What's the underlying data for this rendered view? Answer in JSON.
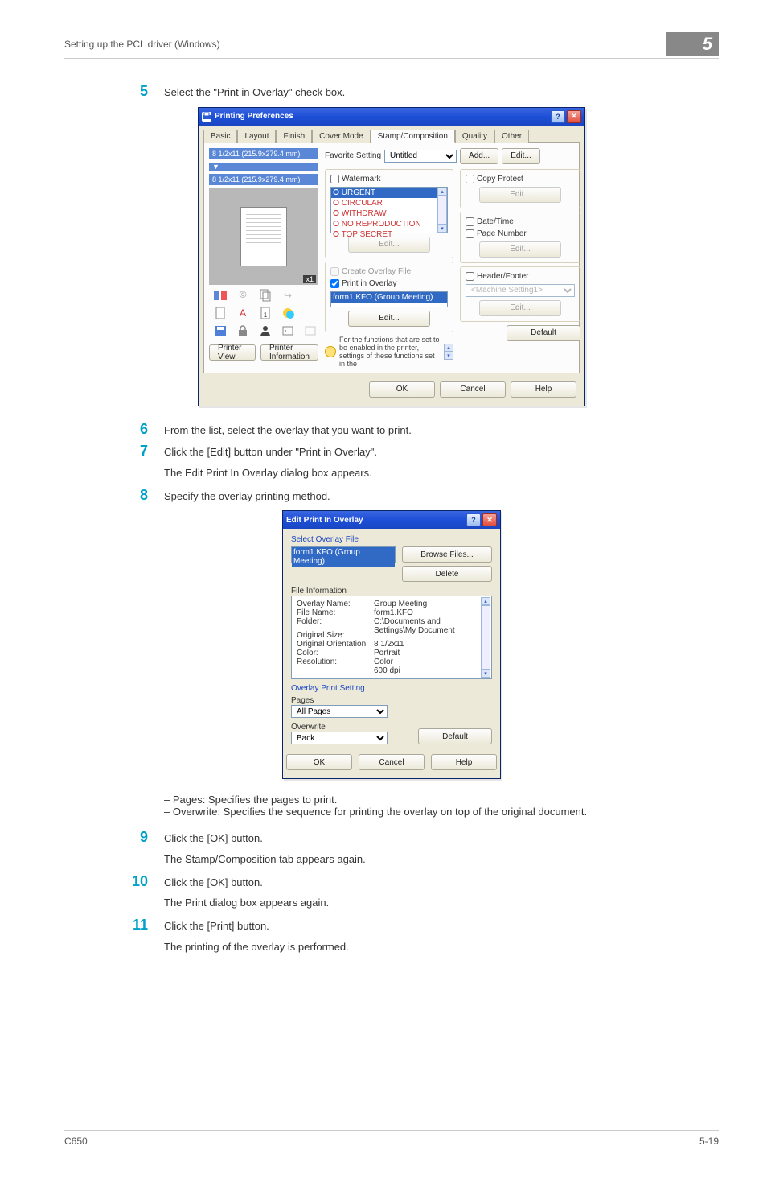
{
  "header": {
    "left": "Setting up the PCL driver (Windows)",
    "chapter": "5"
  },
  "steps": [
    {
      "num": "5",
      "text": "Select the \"Print in Overlay\" check box."
    },
    {
      "num": "6",
      "text": "From the list, select the overlay that you want to print."
    },
    {
      "num": "7",
      "text": "Click the [Edit] button under \"Print in Overlay\".",
      "follow": "The Edit Print In Overlay dialog box appears."
    },
    {
      "num": "8",
      "text": "Specify the overlay printing method."
    },
    {
      "num": "9",
      "text": "Click the [OK] button.",
      "follow": "The Stamp/Composition tab appears again."
    },
    {
      "num": "10",
      "text": "Click the [OK] button.",
      "follow": "The Print dialog box appears again."
    },
    {
      "num": "11",
      "text": "Click the [Print] button.",
      "follow": "The printing of the overlay is performed."
    }
  ],
  "bullets": {
    "pages": "Pages: Specifies the pages to print.",
    "overwrite": "Overwrite: Specifies the sequence for printing the overlay on top of the original document."
  },
  "pp": {
    "title": "Printing Preferences",
    "tabs": [
      "Basic",
      "Layout",
      "Finish",
      "Cover Mode",
      "Stamp/Composition",
      "Quality",
      "Other"
    ],
    "active_tab": "Stamp/Composition",
    "paper1": "8 1/2x11 (215.9x279.4 mm)",
    "paper2": "8 1/2x11 (215.9x279.4 mm)",
    "zoom": "x1",
    "printer_view": "Printer View",
    "printer_info": "Printer Information",
    "fav_label": "Favorite Setting",
    "fav_value": "Untitled",
    "add": "Add...",
    "edit": "Edit...",
    "watermark": "Watermark",
    "wm_items": [
      "URGENT",
      "CIRCULAR",
      "WITHDRAW",
      "NO REPRODUCTION",
      "TOP SECRET"
    ],
    "wm_edit": "Edit...",
    "create_overlay": "Create Overlay File",
    "print_overlay": "Print in Overlay",
    "overlay_item": "form1.KFO (Group Meeting)",
    "ov_edit": "Edit...",
    "copy_protect": "Copy Protect",
    "cp_edit": "Edit...",
    "date_time": "Date/Time",
    "page_number": "Page Number",
    "dt_edit": "Edit...",
    "header_footer": "Header/Footer",
    "hf_sel": "<Machine Setting1>",
    "hf_edit": "Edit...",
    "info_text": "For the functions that are set to be enabled in the printer, settings of these functions set in the",
    "default": "Default",
    "ok": "OK",
    "cancel": "Cancel",
    "help": "Help"
  },
  "epo": {
    "title": "Edit Print In Overlay",
    "sel_overlay": "Select Overlay File",
    "file_sel": "form1.KFO (Group Meeting)",
    "browse": "Browse Files...",
    "delete": "Delete",
    "file_info": "File Information",
    "rows": {
      "ov_name_l": "Overlay Name:",
      "ov_name_v": "Group Meeting",
      "file_name_l": "File Name:",
      "file_name_v": "form1.KFO",
      "folder_l": "Folder:",
      "folder_v": "C:\\Documents and Settings\\My Document",
      "size_l": "Original Size:",
      "size_v": "8 1/2x11",
      "orient_l": "Original Orientation:",
      "orient_v": "Portrait",
      "color_l": "Color:",
      "color_v": "Color",
      "res_l": "Resolution:",
      "res_v": "600 dpi"
    },
    "ops": "Overlay Print Setting",
    "pages_l": "Pages",
    "pages_v": "All Pages",
    "overwrite_l": "Overwrite",
    "overwrite_v": "Back",
    "default": "Default",
    "ok": "OK",
    "cancel": "Cancel",
    "help": "Help"
  },
  "footer": {
    "left": "C650",
    "right": "5-19"
  }
}
